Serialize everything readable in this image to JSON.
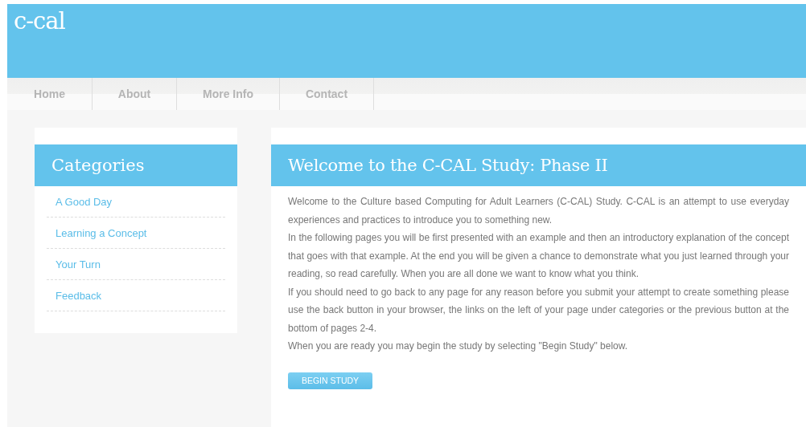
{
  "site_title": "c-cal",
  "nav": [
    {
      "label": "Home"
    },
    {
      "label": "About"
    },
    {
      "label": "More Info"
    },
    {
      "label": "Contact"
    }
  ],
  "sidebar": {
    "title": "Categories",
    "items": [
      "A Good Day",
      "Learning a Concept",
      "Your Turn",
      "Feedback"
    ]
  },
  "main": {
    "title": "Welcome to the C-CAL Study: Phase II",
    "paragraphs": [
      "Welcome to the Culture based Computing for Adult Learners (C-CAL) Study. C-CAL is an attempt to use everyday experiences and practices to introduce you to something new.",
      "In the following pages you will be first presented with an example and then an introductory explanation of the concept that goes with that example. At the end you will be given a chance to demonstrate what you just learned through your reading, so read carefully. When you are all done we want to know what you think.",
      "If you should need to go back to any page for any reason before you submit your attempt to create something please use the back button in your browser, the links on the left of your page under categories or the previous button at the bottom of pages 2-4.",
      "When you are ready you may begin the study by selecting \"Begin Study\" below."
    ],
    "button": "BEGIN STUDY"
  }
}
